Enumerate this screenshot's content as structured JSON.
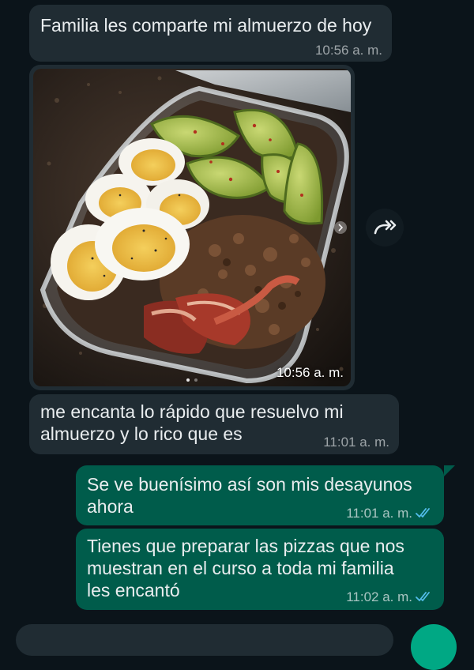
{
  "messages": [
    {
      "type": "incoming",
      "text": "Familia les comparte mi almuerzo de hoy",
      "time": "10:56 a. m."
    },
    {
      "type": "incoming-image",
      "image": "meal-prep-container-with-eggs-avocado-ground-beef-bacon",
      "time": "10:56 a. m."
    },
    {
      "type": "incoming",
      "lines": [
        "me encanta lo rápido que resuelvo mi",
        "almuerzo y lo rico que es"
      ],
      "time": "11:01 a. m."
    },
    {
      "type": "outgoing",
      "lines": [
        "Se ve buenísimo así son mis desayunos",
        "ahora"
      ],
      "time": "11:01 a. m.",
      "status": "read"
    },
    {
      "type": "outgoing",
      "lines": [
        "Tienes que preparar las pizzas que nos",
        "muestran en el curso a toda mi familia",
        "les encantó"
      ],
      "time": "11:02 a. m.",
      "status": "read"
    }
  ],
  "colors": {
    "background": "#0b141a",
    "incoming_bubble": "#202c33",
    "outgoing_bubble": "#005c4b",
    "read_ticks": "#53bdeb",
    "fab": "#00a884"
  },
  "icons": {
    "forward": "forward-icon",
    "double_check": "double-check-icon"
  }
}
